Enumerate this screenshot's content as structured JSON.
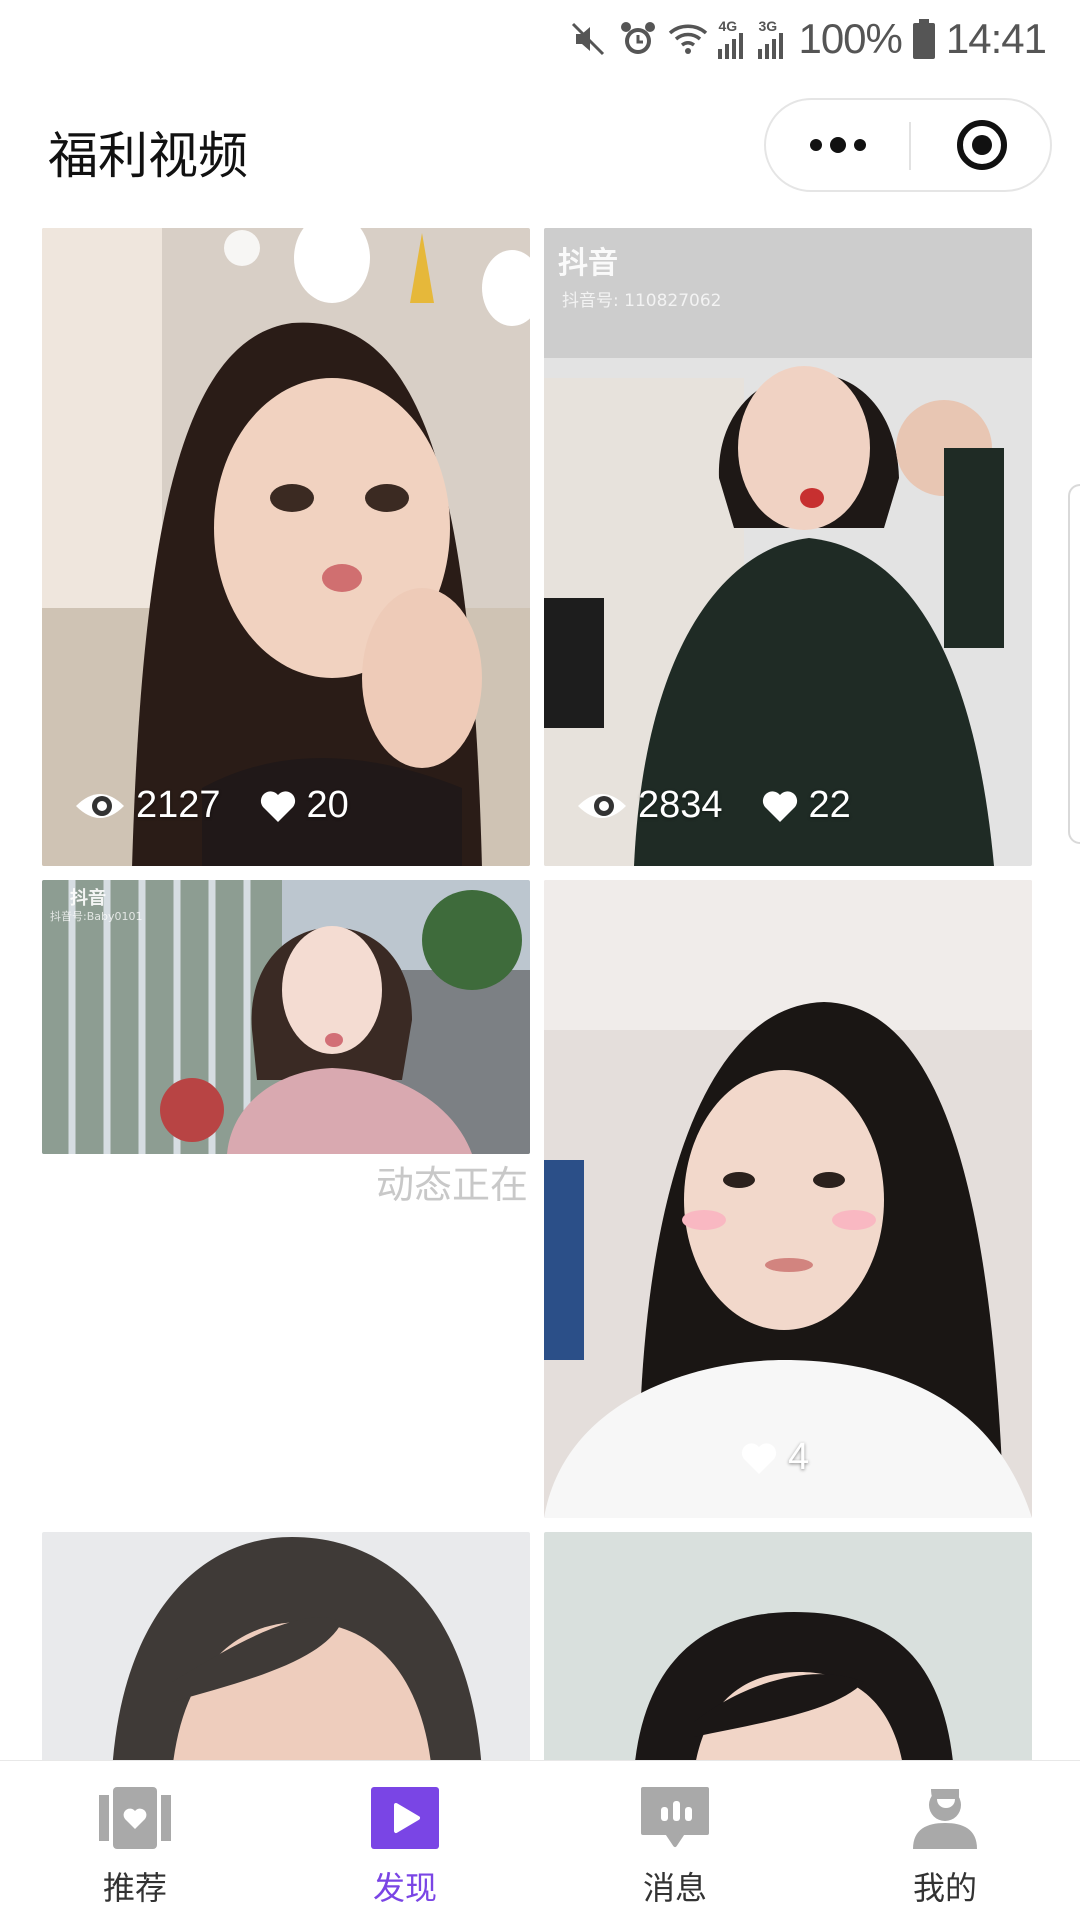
{
  "status_bar": {
    "battery": "100%",
    "time": "14:41",
    "net_4g": "4G",
    "net_3g": "3G",
    "icons": [
      "mute-icon",
      "alarm-icon",
      "wifi-icon",
      "signal-4g-icon",
      "signal-3g-icon",
      "battery-icon"
    ]
  },
  "header": {
    "title": "福利视频",
    "more_icon": "more-dots-icon",
    "close_icon": "target-close-icon"
  },
  "videos": [
    {
      "views": "2127",
      "likes": "20"
    },
    {
      "views": "2834",
      "likes": "22",
      "watermark": "抖音",
      "watermark_id": "抖音号: 110827062"
    },
    {
      "watermark": "抖音",
      "watermark_id": "抖音号:Baby0101"
    },
    {
      "likes": "4"
    },
    {},
    {}
  ],
  "toast": "动态正在",
  "tabbar": {
    "items": [
      {
        "label": "推荐",
        "icon": "heart-card-icon",
        "active": false
      },
      {
        "label": "发现",
        "icon": "play-video-icon",
        "active": true
      },
      {
        "label": "消息",
        "icon": "message-bubble-icon",
        "active": false
      },
      {
        "label": "我的",
        "icon": "user-profile-icon",
        "active": false
      }
    ]
  },
  "colors": {
    "accent": "#7a45e5",
    "inactive_icon": "#a9a9a9",
    "background": "#ffffff"
  }
}
